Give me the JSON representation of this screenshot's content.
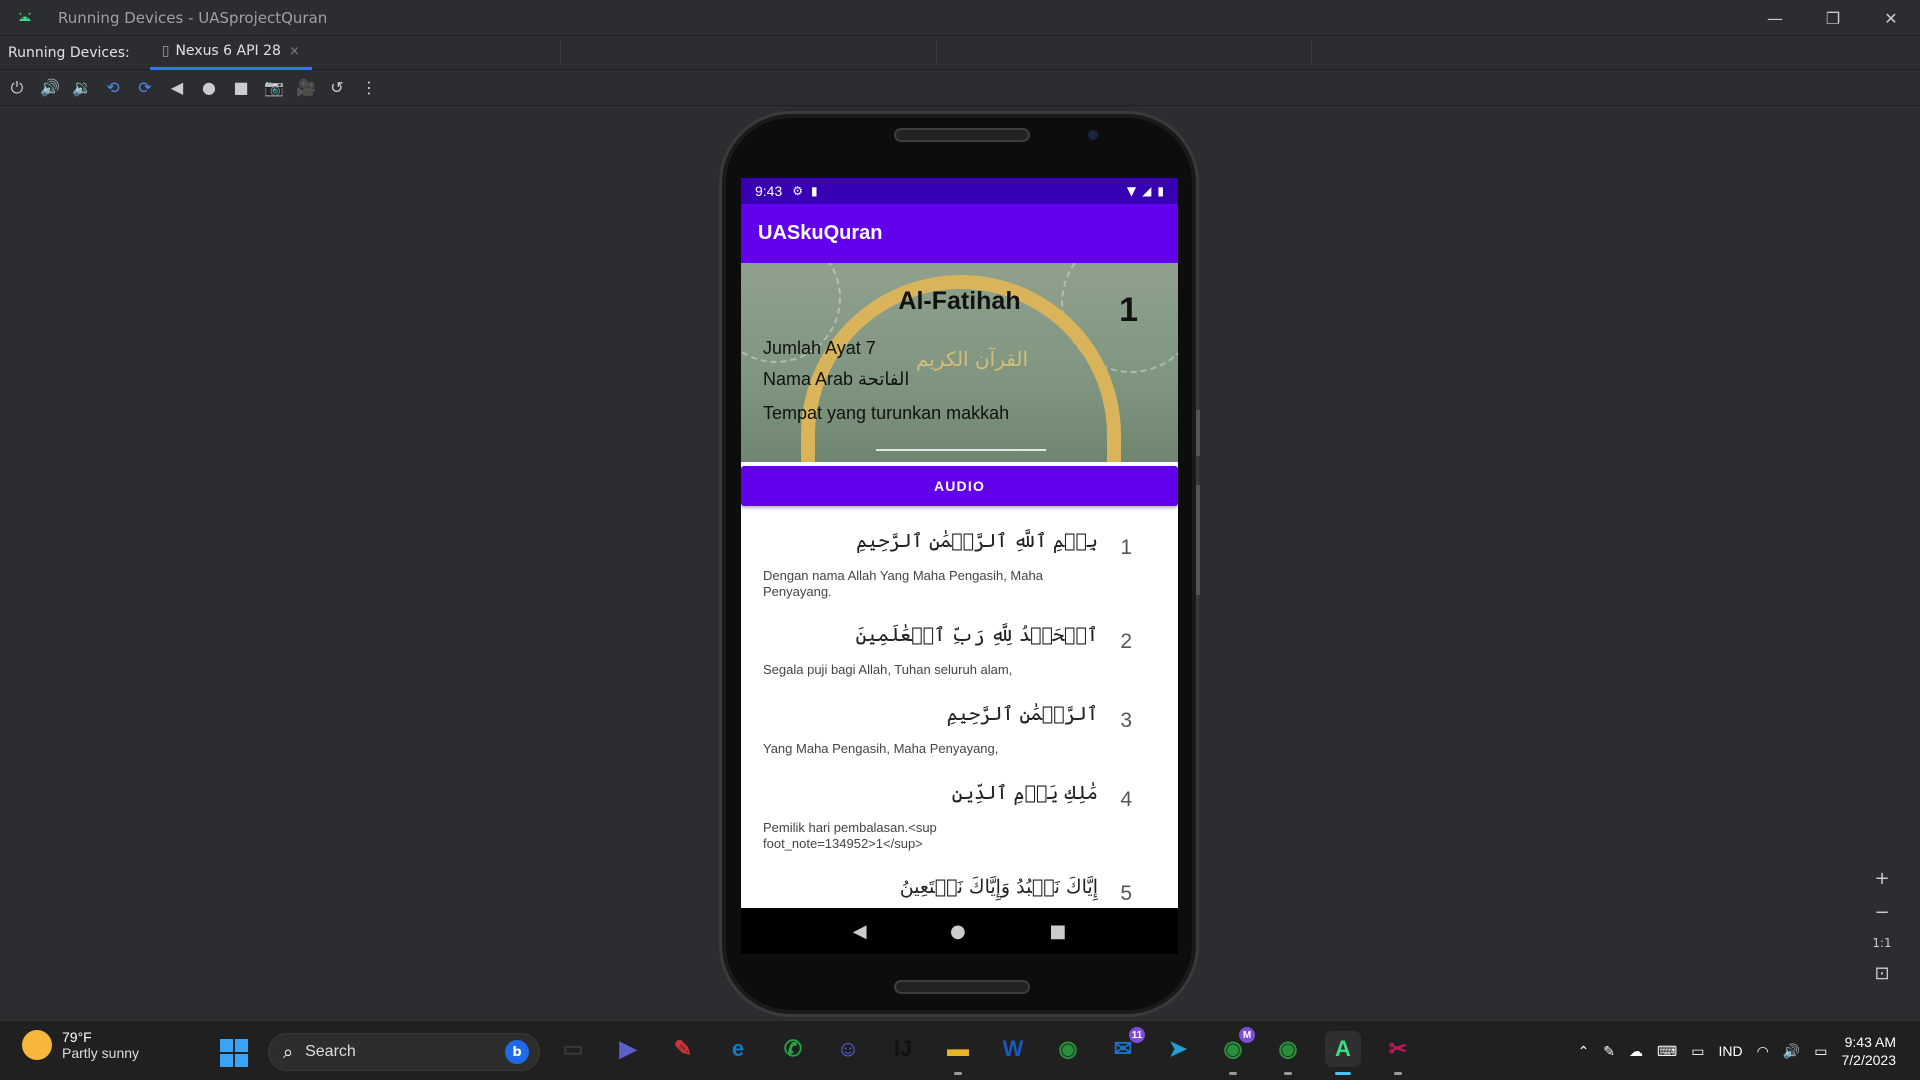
{
  "window": {
    "title": "Running Devices - UASprojectQuran",
    "buttons": [
      "—",
      "❐",
      "✕"
    ]
  },
  "tabs": {
    "label": "Running Devices:",
    "device_tab": "Nexus 6 API 28",
    "close": "×"
  },
  "toolbar": {
    "icons": [
      "power-icon",
      "volume-up-icon",
      "volume-down-icon",
      "rotate-left-icon",
      "rotate-right-icon",
      "back-icon",
      "home-icon",
      "overview-icon",
      "screenshot-icon",
      "screen-record-icon",
      "reset-icon",
      "more-icon"
    ]
  },
  "device": {
    "status_time": "9:43",
    "app_title": "UASkuQuran",
    "surah": {
      "name": "Al-Fatihah",
      "number": "1",
      "jumlah_ayat": "Jumlah Ayat 7",
      "nama_arab": "Nama Arab الفاتحة",
      "tempat": "Tempat yang turunkan makkah",
      "calligraphy": "القرآن الكريم"
    },
    "audio_button": "AUDIO",
    "ayat": [
      {
        "number": "1",
        "arabic": "بِسۡمِ ٱللَّهِ ٱلرَّحۡمَٰنِ ٱلرَّحِيمِ",
        "translation": "Dengan nama Allah Yang Maha Pengasih, Maha Penyayang."
      },
      {
        "number": "2",
        "arabic": "ٱلۡحَمۡدُ لِلَّهِ رَبِّ ٱلۡعَٰلَمِينَ",
        "translation": "Segala puji bagi Allah, Tuhan seluruh alam,"
      },
      {
        "number": "3",
        "arabic": "ٱلرَّحۡمَٰنِ ٱلرَّحِيمِ",
        "translation": "Yang Maha Pengasih, Maha Penyayang,"
      },
      {
        "number": "4",
        "arabic": "مَٰلِكِ يَوۡمِ ٱلدِّينِ",
        "translation": "Pemilik hari pembalasan.<sup foot_note=134952>1</sup>"
      },
      {
        "number": "5",
        "arabic": "إِيَّاكَ نَعۡبُدُ وَإِيَّاكَ نَسۡتَعِينُ",
        "translation": ""
      }
    ],
    "nav": {
      "back": "◀",
      "home": "●",
      "recents": "■"
    }
  },
  "zoom": {
    "plus": "+",
    "minus": "−",
    "one_to_one": "1:1"
  },
  "taskbar": {
    "weather_temp": "79°F",
    "weather_desc": "Partly sunny",
    "search_placeholder": "Search",
    "bing": "b",
    "apps": [
      {
        "name": "task-view",
        "glyph": "▭",
        "color": "#3a3a3a"
      },
      {
        "name": "meet",
        "glyph": "▶",
        "color": "#5b5fc7"
      },
      {
        "name": "reader",
        "glyph": "✎",
        "color": "#d13438"
      },
      {
        "name": "edge",
        "glyph": "e",
        "color": "#0f7cc7"
      },
      {
        "name": "whatsapp",
        "glyph": "✆",
        "color": "#25a244"
      },
      {
        "name": "discord",
        "glyph": "☺",
        "color": "#5865f2"
      },
      {
        "name": "intellij",
        "glyph": "IJ",
        "color": "#111111"
      },
      {
        "name": "explorer",
        "glyph": "▬",
        "color": "#e8b42a"
      },
      {
        "name": "word",
        "glyph": "W",
        "color": "#185abd"
      },
      {
        "name": "chrome",
        "glyph": "◉",
        "color": "#2a8f3b"
      },
      {
        "name": "mail",
        "glyph": "✉",
        "color": "#1a73c9",
        "badge": "11"
      },
      {
        "name": "telegram",
        "glyph": "➤",
        "color": "#229ed9"
      },
      {
        "name": "chrome-profile-m",
        "glyph": "◉",
        "color": "#2a8f3b",
        "badge": "M"
      },
      {
        "name": "chrome-profile-2",
        "glyph": "◉",
        "color": "#2a8f3b"
      },
      {
        "name": "android-studio",
        "glyph": "A",
        "color": "#3ddc84"
      },
      {
        "name": "snipping-tool",
        "glyph": "✂",
        "color": "#c2185b"
      }
    ],
    "tray_language": "IND",
    "time": "9:43 AM",
    "date": "7/2/2023"
  },
  "colors": {
    "ide_bg": "#2b2d30",
    "status_bar": "#3700b3",
    "primary": "#6200ee",
    "accent": "#3574f0"
  }
}
